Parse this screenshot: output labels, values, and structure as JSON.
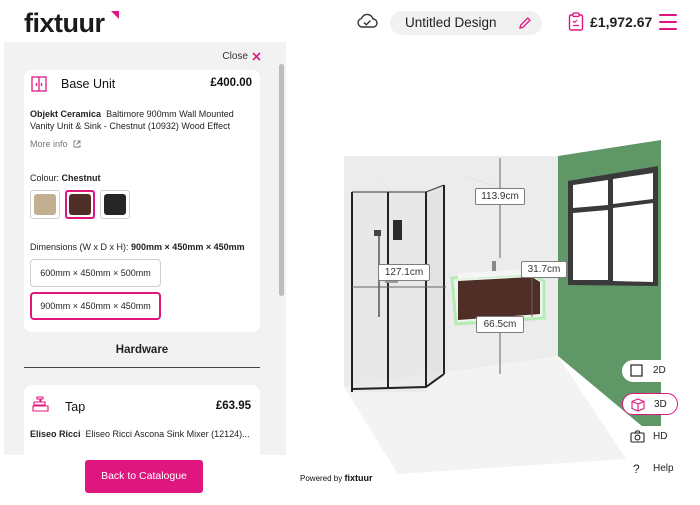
{
  "header": {
    "logo": "fixtuur",
    "design_name": "Untitled Design",
    "total_price": "£1,972.67"
  },
  "panel": {
    "close_label": "Close",
    "product": {
      "title": "Base Unit",
      "price": "£400.00",
      "brand": "Objekt Ceramica",
      "description": "Baltimore 900mm Wall Mounted Vanity Unit & Sink - Chestnut (10932) Wood Effect",
      "more_info": "More info",
      "colour_label": "Colour:",
      "colour_value": "Chestnut",
      "swatches": [
        {
          "name": "Beige",
          "color": "#c2ae91"
        },
        {
          "name": "Chestnut",
          "color": "#4e2e27"
        },
        {
          "name": "Black",
          "color": "#262626"
        }
      ],
      "dimensions_label": "Dimensions (W x D x H):",
      "dimensions_value": "900mm × 450mm × 450mm",
      "dimension_options": [
        "600mm × 450mm × 500mm",
        "900mm × 450mm × 450mm"
      ]
    },
    "hardware_label": "Hardware",
    "tap": {
      "title": "Tap",
      "price": "£63.95",
      "brand": "Eliseo Ricci",
      "description": "Eliseo Ricci Ascona Sink Mixer (12124)..."
    },
    "back_button": "Back to Catalogue"
  },
  "viewer": {
    "dimensions": {
      "height_above": "113.9cm",
      "shower_width": "127.1cm",
      "depth": "31.7cm",
      "width": "66.5cm"
    },
    "powered_by": "Powered by",
    "powered_brand": "fixtuur",
    "view_buttons": {
      "two_d": "2D",
      "three_d": "3D",
      "hd": "HD",
      "help": "Help"
    }
  },
  "colors": {
    "accent": "#e0167f",
    "wall_green": "#5f9766"
  }
}
